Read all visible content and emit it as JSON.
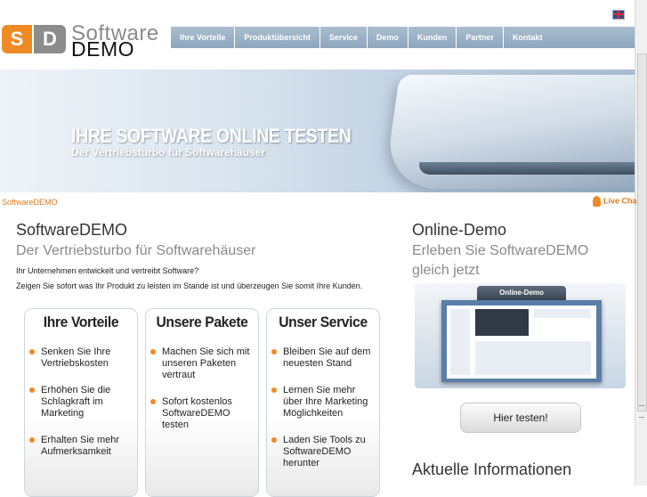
{
  "logo": {
    "mark_s": "S",
    "mark_d": "D",
    "software": "Software",
    "demo": "DEMO"
  },
  "nav": [
    "Ihre Vorteile",
    "Produktübersicht",
    "Service",
    "Demo",
    "Kunden",
    "Partner",
    "Kontakt"
  ],
  "banner": {
    "title": "IHRE SOFTWARE ONLINE TESTEN",
    "subtitle": "Der Vertriebsturbo für Softwarehäuser"
  },
  "breadcrumb": "SoftwareDEMO",
  "livechat": "Live Cha",
  "main": {
    "title": "SoftwareDEMO",
    "subtitle": "Der Vertriebsturbo für Softwarehäuser",
    "intro": [
      "Ihr Unternehmen entwickelt und vertreibt Software?",
      "Zeigen Sie sofort was Ihr Produkt zu leisten im Stande ist und überzeugen Sie somit Ihre Kunden."
    ],
    "boxes": [
      {
        "title": "Ihre Vorteile",
        "items": [
          "Senken Sie Ihre Vertriebskosten",
          "Erhöhen Sie die Schlagkraft im Marketing",
          "Erhalten Sie mehr Aufmerksamkeit"
        ]
      },
      {
        "title": "Unsere Pakete",
        "items": [
          "Machen Sie sich mit unseren Paketen vertraut",
          "Sofort kostenlos SoftwareDEMO testen"
        ]
      },
      {
        "title": "Unser Service",
        "items": [
          "Bleiben Sie auf dem neuesten Stand",
          "Lernen Sie mehr über Ihre Marketing Möglichkeiten",
          "Laden Sie Tools zu SoftwareDEMO herunter"
        ]
      }
    ]
  },
  "sidebar": {
    "title": "Online-Demo",
    "subtitle": "Erleben Sie SoftwareDEMO gleich jetzt",
    "preview_tab": "Online-Demo",
    "button": "Hier testen!",
    "news_title": "Aktuelle Informationen"
  },
  "colors": {
    "accent": "#f08a24",
    "nav": "#9cb2c7",
    "text": "#333333",
    "muted": "#8a8a8a"
  }
}
